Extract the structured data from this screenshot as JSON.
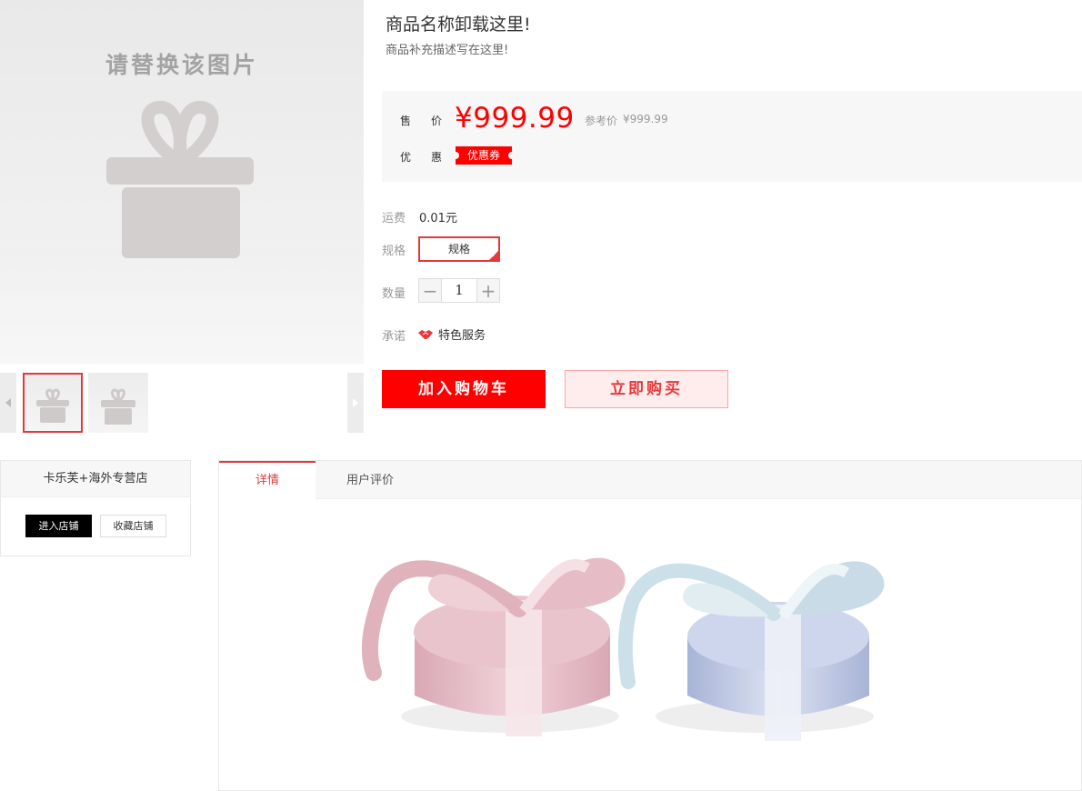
{
  "gallery": {
    "placeholder_text": "请替换该图片",
    "thumbnails": [
      {
        "name": "thumb-1",
        "selected": true
      },
      {
        "name": "thumb-2",
        "selected": false
      }
    ]
  },
  "product": {
    "title": "商品名称卸载这里!",
    "subtitle": "商品补充描述写在这里!"
  },
  "price": {
    "sale_label": "售价",
    "sale_price": "¥999.99",
    "ref_label": "参考价",
    "ref_price": "¥999.99",
    "promo_label": "优惠",
    "coupon": "优惠券"
  },
  "attrs": {
    "freight_label": "运费",
    "freight_value": "0.01元",
    "spec_label": "规格",
    "spec_option": "规格",
    "qty_label": "数量",
    "qty_value": "1",
    "promise_label": "承诺",
    "service": "特色服务"
  },
  "actions": {
    "add_to_cart": "加入购物车",
    "buy_now": "立即购买"
  },
  "store": {
    "name": "卡乐芙+海外专营店",
    "enter": "进入店铺",
    "favorite": "收藏店铺"
  },
  "tabs": [
    {
      "label": "详情",
      "active": true
    },
    {
      "label": "用户评价",
      "active": false
    }
  ],
  "colors": {
    "accent": "#ff0000",
    "brand_red": "#e4393c"
  }
}
